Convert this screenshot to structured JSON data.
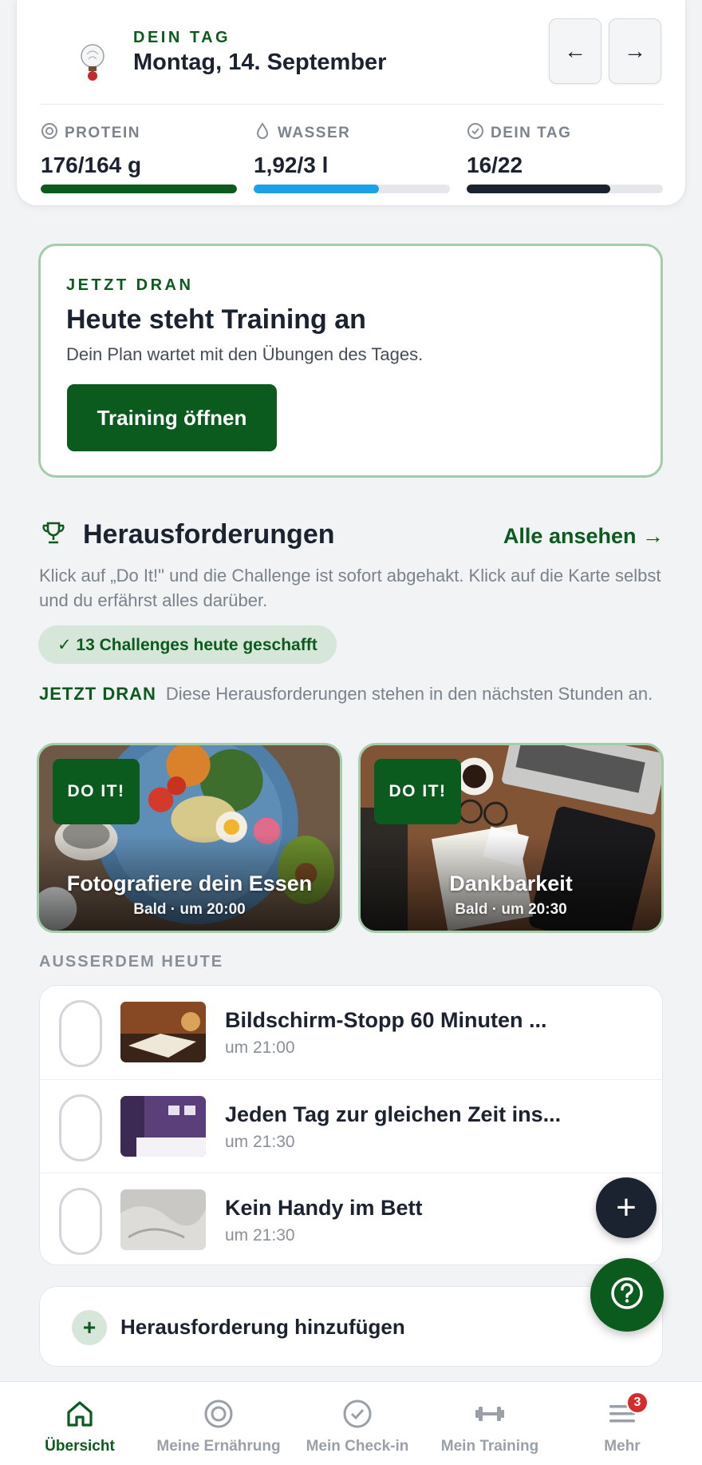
{
  "header": {
    "eyebrow": "DEIN TAG",
    "date": "Montag, 14. September",
    "prev_icon": "arrow-left-icon",
    "next_icon": "arrow-right-icon",
    "prev_symbol": "←",
    "next_symbol": "→"
  },
  "stats": [
    {
      "label": "PROTEIN",
      "value": "176/164 g",
      "progress": 1.0,
      "color": "#0b5b1e",
      "icon": "target-icon"
    },
    {
      "label": "WASSER",
      "value": "1,92/3 l",
      "progress": 0.64,
      "color": "#1ea0e6",
      "icon": "drop-icon"
    },
    {
      "label": "DEIN TAG",
      "value": "16/22",
      "progress": 0.73,
      "color": "#1b2230",
      "icon": "check-circle-icon"
    }
  ],
  "now_card": {
    "eyebrow": "JETZT DRAN",
    "title": "Heute steht Training an",
    "subtitle": "Dein Plan wartet mit den Übungen des Tages.",
    "button": "Training öffnen"
  },
  "challenges": {
    "title": "Herausforderungen",
    "see_all": "Alle ansehen →",
    "description": "Klick auf „Do It!\" und die Challenge ist sofort abgehakt. Klick auf die Karte selbst und du erfährst alles darüber.",
    "done_pill": "✓ 13 Challenges heute geschafft",
    "now_label": "JETZT DRAN",
    "now_text": "Diese Herausforderungen stehen in den nächsten Stunden an.",
    "tiles": [
      {
        "badge": "DO IT!",
        "title": "Fotografiere dein Essen",
        "subtitle": "Bald · um 20:00"
      },
      {
        "badge": "DO IT!",
        "title": "Dankbarkeit",
        "subtitle": "Bald · um 20:30"
      }
    ],
    "also_label": "AUSSERDEM HEUTE",
    "list": [
      {
        "title": "Bildschirm-Stopp 60 Minuten ...",
        "time": "um 21:00"
      },
      {
        "title": "Jeden Tag zur gleichen Zeit ins...",
        "time": "um 21:30"
      },
      {
        "title": "Kein Handy im Bett",
        "time": "um 21:30"
      }
    ],
    "add_label": "Herausforderung hinzufügen",
    "add_symbol": "+",
    "fab_symbol": "+"
  },
  "bottom_nav": [
    {
      "label": "Übersicht",
      "icon": "home-icon",
      "active": true
    },
    {
      "label": "Meine Ernährung",
      "icon": "target-icon",
      "active": false
    },
    {
      "label": "Mein Check-in",
      "icon": "check-circle-icon",
      "active": false
    },
    {
      "label": "Mein Training",
      "icon": "dumbbell-icon",
      "active": false
    },
    {
      "label": "Mehr",
      "icon": "menu-icon",
      "active": false,
      "badge": "3"
    }
  ]
}
